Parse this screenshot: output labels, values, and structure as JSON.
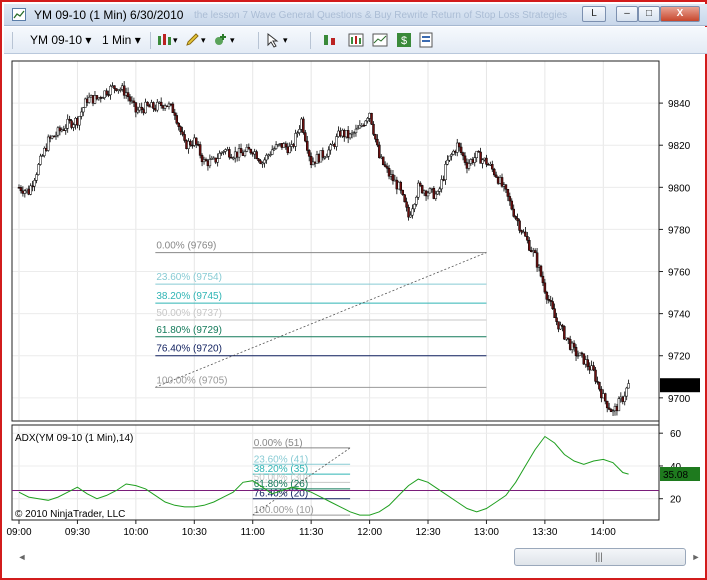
{
  "window": {
    "title": "YM 09-10 (1 Min)  6/30/2010",
    "background_text": "the lesson 7 Wave General Questions & Buy Rewrite Return of Stop Loss Strategies",
    "buttons": {
      "layout": "L",
      "minimize": "–",
      "maximize": "□",
      "close": "X"
    }
  },
  "toolbar": {
    "instrument": "YM 09-10",
    "interval": "1 Min",
    "icons": [
      "bar-chart-icon",
      "pencil-icon",
      "data-box-icon",
      "cursor-icon",
      "indicators-icon",
      "strategies-icon",
      "chart-properties-icon",
      "dollar-icon",
      "panel-icon"
    ]
  },
  "colors": {
    "up": "#ffffff",
    "down": "#6b0f0f",
    "wick": "#000000",
    "adx": "#1f9f1f",
    "threshold": "#7a1d7a",
    "price_badge": "#000000",
    "adx_badge": "#1e7a1e"
  },
  "chart_data": [
    {
      "type": "candlestick",
      "title": "YM 09-10 (1 Min)  6/30/2010",
      "x_tick_labels": [
        "09:00",
        "09:30",
        "10:00",
        "10:30",
        "11:00",
        "11:30",
        "12:00",
        "12:30",
        "13:00",
        "13:30",
        "14:00"
      ],
      "y_tick_labels": [
        "9840",
        "9820",
        "9800",
        "9780",
        "9760",
        "9740",
        "9720",
        "9700"
      ],
      "ylim": [
        9689,
        9860
      ],
      "last_price": "9706",
      "price_path_minutes": [
        0,
        5,
        10,
        15,
        20,
        25,
        30,
        35,
        40,
        45,
        50,
        55,
        60,
        65,
        70,
        75,
        80,
        85,
        90,
        95,
        100,
        105,
        110,
        115,
        120,
        125,
        130,
        135,
        140,
        145,
        150,
        155,
        160,
        165,
        170,
        175,
        180,
        185,
        190,
        195,
        200,
        205,
        210,
        215,
        220,
        225,
        230,
        235,
        240,
        245,
        250,
        255,
        260,
        265,
        270,
        275,
        280,
        285,
        290,
        295,
        300,
        305,
        310,
        313
      ],
      "price_path_values": [
        9800,
        9798,
        9810,
        9822,
        9826,
        9830,
        9832,
        9842,
        9842,
        9846,
        9848,
        9845,
        9836,
        9838,
        9838,
        9840,
        9836,
        9820,
        9822,
        9812,
        9812,
        9818,
        9816,
        9816,
        9818,
        9812,
        9818,
        9820,
        9818,
        9832,
        9812,
        9815,
        9818,
        9826,
        9824,
        9828,
        9836,
        9814,
        9806,
        9800,
        9786,
        9800,
        9798,
        9796,
        9812,
        9820,
        9811,
        9815,
        9812,
        9806,
        9797,
        9786,
        9776,
        9767,
        9752,
        9738,
        9730,
        9722,
        9718,
        9712,
        9700,
        9693,
        9700,
        9706
      ],
      "fibonacci": {
        "anchors": [
          {
            "minute": 70,
            "value": 9705
          },
          {
            "minute": 240,
            "value": 9769
          }
        ],
        "levels": [
          {
            "label": "0.00% (9769)",
            "value": 9769,
            "color": "#888888"
          },
          {
            "label": "23.60% (9754)",
            "value": 9754,
            "color": "#88cbd4"
          },
          {
            "label": "38.20% (9745)",
            "value": 9745,
            "color": "#2fb4b4"
          },
          {
            "label": "50.00% (9737)",
            "value": 9737,
            "color": "#c7c7c7"
          },
          {
            "label": "61.80% (9729)",
            "value": 9729,
            "color": "#137a5a"
          },
          {
            "label": "76.40% (9720)",
            "value": 9720,
            "color": "#0e1e5e"
          },
          {
            "label": "100.00% (9705)",
            "value": 9705,
            "color": "#999999"
          }
        ]
      }
    },
    {
      "type": "line",
      "title": "ADX(YM 09-10 (1 Min),14)",
      "y_tick_labels": [
        "60",
        "40",
        "20"
      ],
      "ylim": [
        7,
        65
      ],
      "last_value": "35.08",
      "threshold": 25,
      "series": [
        {
          "x_minutes": [
            0,
            5,
            10,
            15,
            20,
            25,
            30,
            35,
            40,
            45,
            50,
            55,
            60,
            65,
            70,
            75,
            80,
            85,
            90,
            95,
            100,
            105,
            110,
            115,
            120,
            125,
            130,
            135,
            140,
            145,
            150,
            155,
            160,
            165,
            170,
            175,
            180,
            185,
            190,
            195,
            200,
            205,
            210,
            215,
            220,
            225,
            230,
            235,
            240,
            245,
            250,
            255,
            260,
            265,
            270,
            275,
            280,
            285,
            290,
            295,
            300,
            305,
            310,
            313
          ],
          "values": [
            24,
            21,
            20,
            19,
            21,
            24,
            27,
            23,
            20,
            22,
            25,
            29,
            28,
            26,
            22,
            18,
            16,
            15,
            15,
            16,
            18,
            21,
            24,
            30,
            31,
            27,
            23,
            25,
            27,
            26,
            24,
            21,
            18,
            15,
            12,
            10,
            10,
            12,
            16,
            22,
            28,
            32,
            30,
            26,
            22,
            18,
            14,
            12,
            14,
            18,
            22,
            30,
            40,
            50,
            58,
            54,
            47,
            43,
            41,
            43,
            44,
            42,
            36,
            35
          ]
        }
      ],
      "fibonacci": {
        "anchors": [
          {
            "minute": 120,
            "value": 10
          },
          {
            "minute": 170,
            "value": 51
          }
        ],
        "levels": [
          {
            "label": "0.00% (51)",
            "value": 51,
            "color": "#888888"
          },
          {
            "label": "23.60% (41)",
            "value": 41,
            "color": "#88cbd4"
          },
          {
            "label": "38.20% (35)",
            "value": 35,
            "color": "#2fb4b4"
          },
          {
            "label": "50.00% (30)",
            "value": 30,
            "color": "#c7c7c7"
          },
          {
            "label": "61.80% (26)",
            "value": 26,
            "color": "#137a5a"
          },
          {
            "label": "76.40% (20)",
            "value": 20,
            "color": "#0e1e5e"
          },
          {
            "label": "100.00% (10)",
            "value": 10,
            "color": "#999999"
          }
        ]
      }
    }
  ],
  "copyright": "© 2010 NinjaTrader, LLC",
  "scrollbar": {
    "left_arrow": "◄",
    "right_arrow": "►",
    "grip": "|||"
  }
}
